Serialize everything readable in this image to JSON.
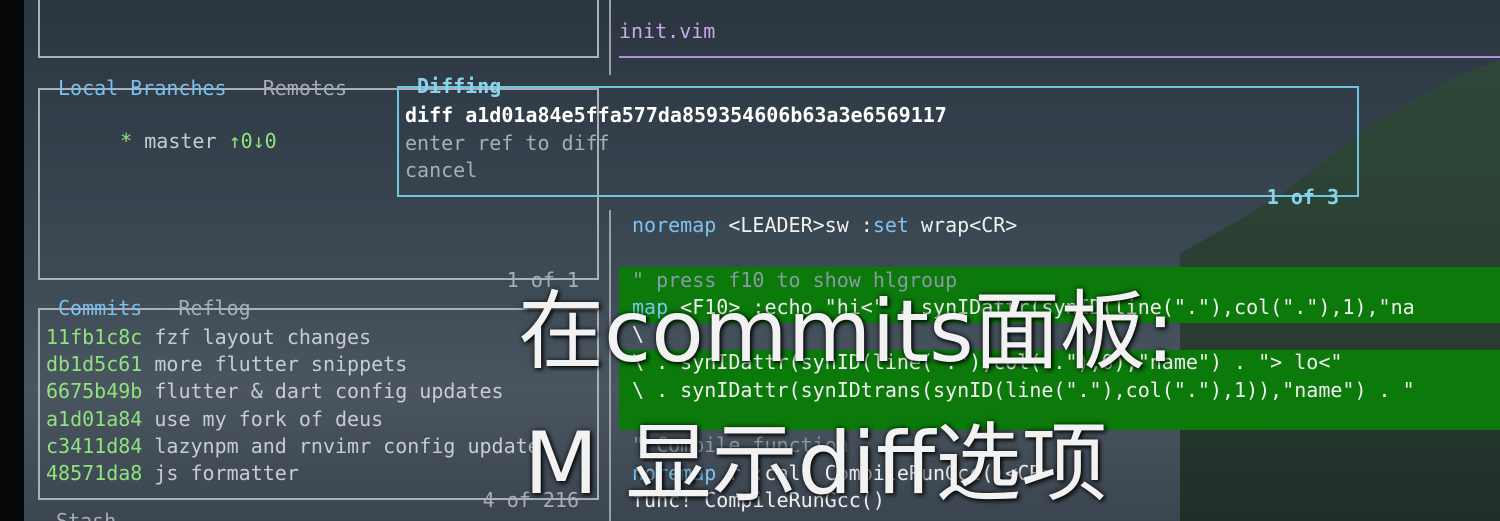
{
  "editor": {
    "filename": "init.vim",
    "lines": [
      {
        "parts": [
          [
            "noremap",
            "kw"
          ],
          [
            " <LEADER>sw :",
            "str"
          ],
          [
            "set",
            "kw"
          ],
          [
            " wrap<CR>",
            "str"
          ]
        ]
      },
      {
        "parts": [
          [
            "\" press f10 to show hlgroup",
            "cmt"
          ]
        ]
      },
      {
        "parts": [
          [
            "map",
            "kw"
          ],
          [
            " <F10> :echo \"hi<\" . synIDattr(synID(line(\".\"),col(\".\"),1),\"na",
            "str"
          ]
        ]
      },
      {
        "parts": [
          [
            "\\",
            "str"
          ]
        ]
      },
      {
        "parts": [
          [
            "\\ . synIDattr(synID(line(\".\"),col(\".\"),0),\"name\") . \"> lo<\"",
            "str"
          ]
        ]
      },
      {
        "parts": [
          [
            "\\ . synIDattr(synIDtrans(synID(line(\".\"),col(\".\"),1)),\"name\") . \"",
            "str"
          ]
        ]
      },
      {
        "parts": [
          [
            "\" Compile function",
            "cmt"
          ]
        ]
      },
      {
        "parts": [
          [
            "noremap",
            "kw"
          ],
          [
            " r :call CompileRunGcc()<CR>",
            "str"
          ]
        ]
      },
      {
        "parts": [
          [
            "func! CompileRunGcc()",
            "str"
          ]
        ]
      }
    ]
  },
  "branches": {
    "title": "Local Branches",
    "title_sep": " - ",
    "remotes_label": "Remotes",
    "items": [
      {
        "marker": "*",
        "name": "master",
        "status": "↑0↓0"
      }
    ],
    "footer": "1 of 1"
  },
  "diff_menu": {
    "title": "Diffing",
    "options": [
      {
        "label": "diff a1d01a84e5ffa577da859354606b63a3e6569117"
      },
      {
        "label": "enter ref to diff"
      },
      {
        "label": "cancel"
      }
    ],
    "footer": "1 of 3"
  },
  "commits": {
    "title": "Commits",
    "title_sep": " - ",
    "reflog_label": "Reflog",
    "items": [
      {
        "hash": "11fb1c8c",
        "message": "fzf layout changes"
      },
      {
        "hash": "db1d5c61",
        "message": "more flutter snippets"
      },
      {
        "hash": "6675b49b",
        "message": "flutter & dart config updates"
      },
      {
        "hash": "a1d01a84",
        "message": "use my fork of deus"
      },
      {
        "hash": "c3411d84",
        "message": "lazynpm and rnvimr config update"
      },
      {
        "hash": "48571da8",
        "message": "js formatter"
      }
    ],
    "footer": "4 of 216"
  },
  "stash_partial": "Stash",
  "subtitle": {
    "line1": "在commits面板:",
    "line2": "M 显示diff选项"
  },
  "colors": {
    "accent_green": "#8fe37f",
    "diff_border": "#6fc7df",
    "highlight_bg": "#0b7a0b",
    "editor_tab_underline": "#b58be0"
  }
}
